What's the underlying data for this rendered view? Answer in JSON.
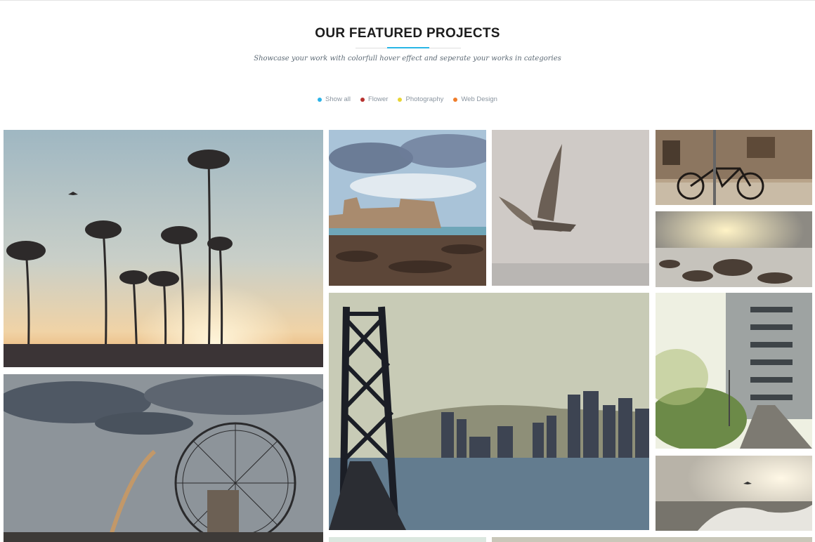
{
  "section": {
    "title": "OUR FEATURED PROJECTS",
    "subtitle": "Showcase your work with colorfull hover effect and seperate your works in categories"
  },
  "filters": [
    {
      "label": "Show all",
      "color": "#2bb3e8"
    },
    {
      "label": "Flower",
      "color": "#b7322f"
    },
    {
      "label": "Photography",
      "color": "#e8d533"
    },
    {
      "label": "Web Design",
      "color": "#ef7d2b"
    }
  ],
  "gallery": [
    {
      "subject": "palm-trees-sunset"
    },
    {
      "subject": "seaside-fortress"
    },
    {
      "subject": "flying-seagull"
    },
    {
      "subject": "bicycle-street"
    },
    {
      "subject": "rocky-shore-sunset"
    },
    {
      "subject": "ferris-wheel-rainbow"
    },
    {
      "subject": "bay-bridge-skyline"
    },
    {
      "subject": "misty-street-building"
    },
    {
      "subject": "seagull-over-waves"
    }
  ]
}
